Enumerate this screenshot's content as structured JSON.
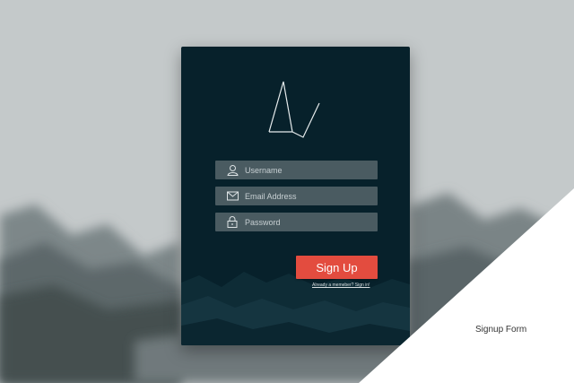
{
  "form": {
    "username_placeholder": "Username",
    "email_placeholder": "Email Address",
    "password_placeholder": "Password",
    "signup_label": "Sign Up",
    "signin_link": "Already a memeber? Sign in!"
  },
  "caption": "Signup Form",
  "colors": {
    "background": "#c4c9ca",
    "card": "#07212b",
    "field": "#4a5b61",
    "button": "#e34c3f",
    "corner": "#ffffff"
  },
  "icons": [
    "logo-icon",
    "user-icon",
    "mail-icon",
    "lock-icon"
  ]
}
